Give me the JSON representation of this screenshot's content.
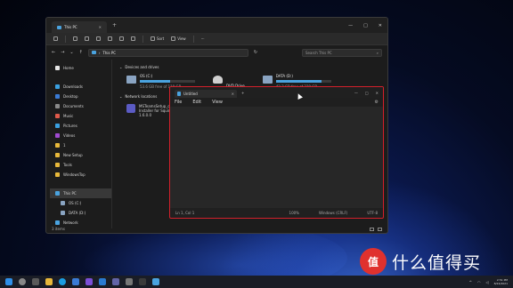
{
  "colors": {
    "accent": "#4aa3df",
    "notepad_border": "#d4202b",
    "background": "#0b1a52"
  },
  "explorer": {
    "tab_title": "This PC",
    "window_controls": [
      "—",
      "□",
      "✕"
    ],
    "toolbar": {
      "sort_label": "Sort",
      "view_label": "View",
      "more_label": "···"
    },
    "address": "This PC",
    "search_placeholder": "Search This PC",
    "sidebar": {
      "items": [
        {
          "label": "Home",
          "color": "#e6e6e6",
          "kind": "item"
        },
        {
          "label": "Downloads",
          "color": "#3aa0e0",
          "kind": "item"
        },
        {
          "label": "Desktop",
          "color": "#3a7bd5",
          "kind": "item"
        },
        {
          "label": "Documents",
          "color": "#8a8a8a",
          "kind": "item"
        },
        {
          "label": "Music",
          "color": "#e05a4a",
          "kind": "item"
        },
        {
          "label": "Pictures",
          "color": "#3aa0e0",
          "kind": "item"
        },
        {
          "label": "Videos",
          "color": "#a04ad0",
          "kind": "item"
        },
        {
          "label": "1",
          "color": "#e8b83a",
          "kind": "item"
        },
        {
          "label": "New Setup",
          "color": "#e8b83a",
          "kind": "item"
        },
        {
          "label": "Tools",
          "color": "#e8b83a",
          "kind": "item"
        },
        {
          "label": "WindowsTop",
          "color": "#e8b83a",
          "kind": "item"
        }
      ],
      "this_pc": "This PC",
      "os_drive": "OS (C:)",
      "data_drive": "DATA (D:)",
      "network": "Network"
    },
    "sections": {
      "drives": "Devices and drives",
      "network": "Network locations"
    },
    "drives": [
      {
        "name": "OS (C:)",
        "free": "53.6 GB free of 119 GB",
        "used_fraction": 0.55
      },
      {
        "name": "DATA (D:)",
        "free": "42.3 GB free of 238 GB",
        "used_fraction": 0.82
      }
    ],
    "dvd": {
      "name": "DVD Drive"
    },
    "network_item": {
      "line1": "MSTeamsSetup_c_l_.exe",
      "line2": "Installer for Squirrel-based",
      "line3": "1.6.0.0"
    },
    "status": "3 items"
  },
  "notepad": {
    "tab_title": "Untitled",
    "menus": [
      "File",
      "Edit",
      "View"
    ],
    "status": {
      "position": "Ln 1, Col 1",
      "zoom": "100%",
      "line_ending": "Windows (CRLF)",
      "encoding": "UTF-8"
    },
    "controls": [
      "—",
      "□",
      "✕"
    ]
  },
  "taskbar": {
    "time": "2:51 PM",
    "date": "8/24/2021"
  },
  "watermark": {
    "badge": "值",
    "text": "什么值得买"
  }
}
